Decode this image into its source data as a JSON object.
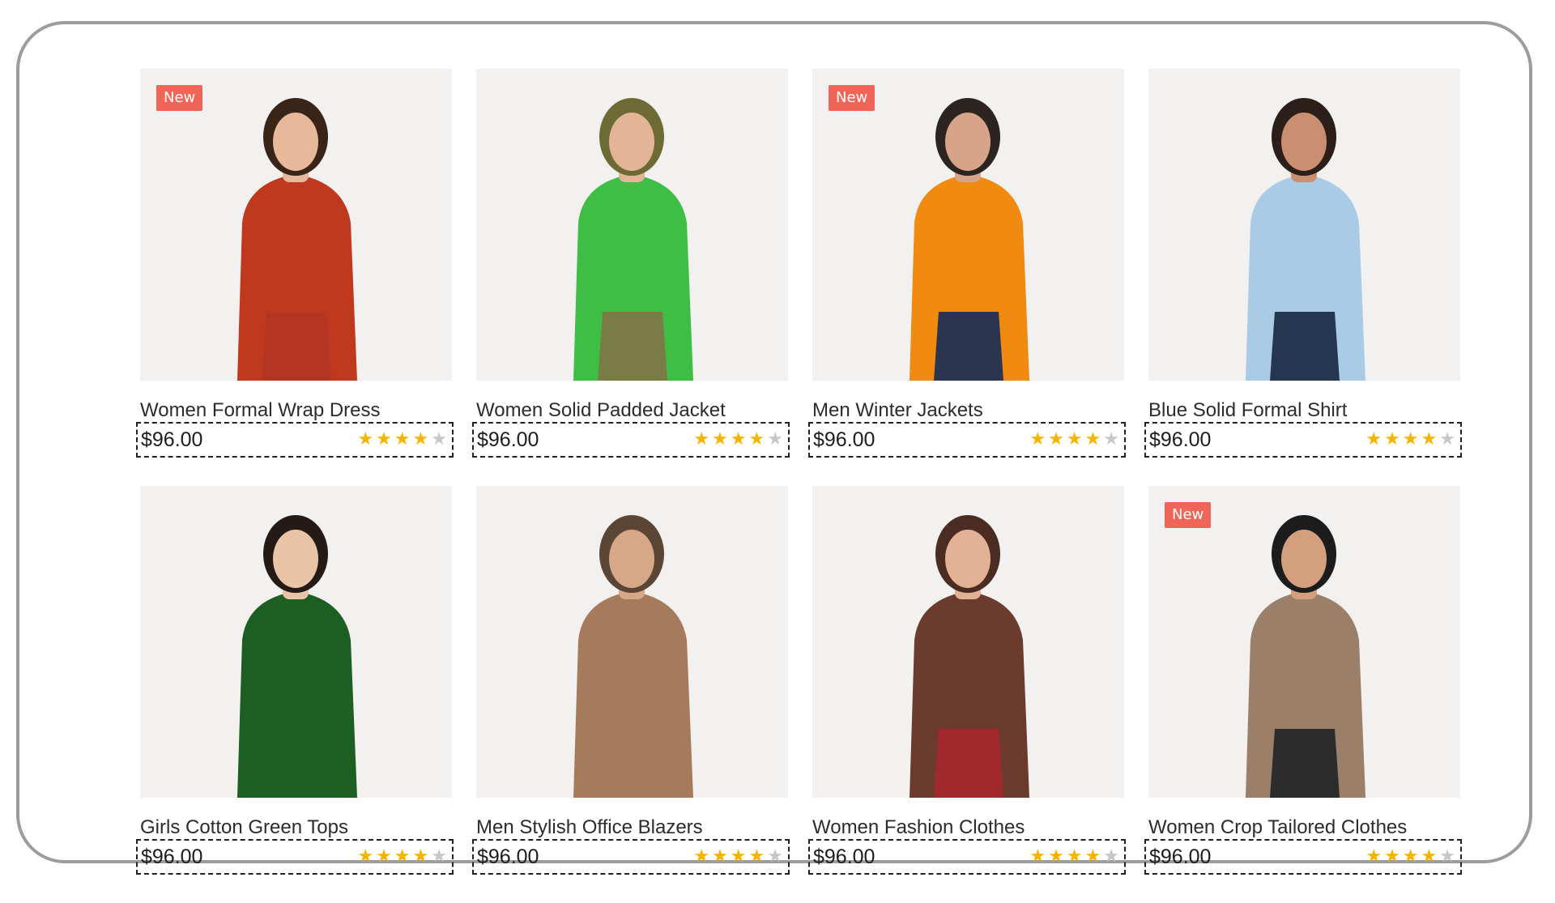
{
  "products": [
    {
      "badge": "New",
      "title": "Women Formal Wrap Dress",
      "price": "$96.00",
      "rating": 4,
      "figure": {
        "top": "#c0391f",
        "bottom": "#b43521",
        "hair": "#3a2418",
        "skin": "#e7b99a"
      }
    },
    {
      "badge": "",
      "title": "Women Solid Padded Jacket",
      "price": "$96.00",
      "rating": 4,
      "figure": {
        "top": "#3fbe45",
        "bottom": "#7a7c46",
        "hair": "#6e6a35",
        "skin": "#e4b496"
      }
    },
    {
      "badge": "New",
      "title": "Men Winter Jackets",
      "price": "$96.00",
      "rating": 4,
      "figure": {
        "top": "#f08a10",
        "bottom": "#2b3550",
        "hair": "#2b2420",
        "skin": "#d7a489"
      }
    },
    {
      "badge": "",
      "title": "Blue Solid Formal Shirt",
      "price": "$96.00",
      "rating": 4,
      "figure": {
        "top": "#a9cbe6",
        "bottom": "#253650",
        "hair": "#2c1e18",
        "skin": "#c98f70"
      }
    },
    {
      "badge": "",
      "title": "Girls Cotton Green Tops",
      "price": "$96.00",
      "rating": 4,
      "figure": {
        "top": "#1d5e22",
        "bottom": "#1d5e22",
        "hair": "#241a16",
        "skin": "#eac4a6"
      }
    },
    {
      "badge": "",
      "title": "Men Stylish Office Blazers",
      "price": "$96.00",
      "rating": 4,
      "figure": {
        "top": "#a57b5c",
        "bottom": "#a57b5c",
        "hair": "#5b4535",
        "skin": "#d6a888"
      }
    },
    {
      "badge": "",
      "title": "Women Fashion Clothes",
      "price": "$96.00",
      "rating": 4,
      "figure": {
        "top": "#6b3b2e",
        "bottom": "#a1282c",
        "hair": "#4a2c22",
        "skin": "#e2b196"
      }
    },
    {
      "badge": "New",
      "title": "Women Crop Tailored Clothes",
      "price": "$96.00",
      "rating": 4,
      "figure": {
        "top": "#9b7f68",
        "bottom": "#2c2c2c",
        "hair": "#1c1c1c",
        "skin": "#d39f7d"
      }
    }
  ],
  "rating_max": 5,
  "colors": {
    "badge_bg": "#ef6659",
    "star_filled": "#f4b400",
    "star_empty": "#c7c7c7",
    "image_bg": "#f2f1f0",
    "frame_border": "#9c9c9c"
  }
}
